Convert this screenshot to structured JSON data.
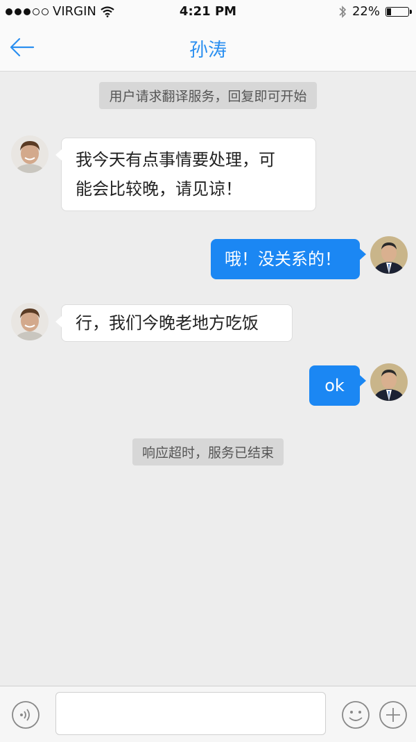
{
  "status_bar": {
    "carrier": "VIRGIN",
    "time": "4:21 PM",
    "battery_percent": "22%",
    "battery_level": 0.22,
    "signal_dots_filled": 3,
    "signal_dots_total": 5
  },
  "nav": {
    "title": "孙涛",
    "back_icon": "back-arrow-icon",
    "accent_color": "#2a8ff0"
  },
  "chat": {
    "system_start": "用户请求翻译服务，回复即可开始",
    "messages": [
      {
        "from": "them",
        "text_line1": "我今天有点事情要处理，可",
        "text_line2": "能会比较晚，请见谅！"
      },
      {
        "from": "me",
        "text": "哦！没关系的！"
      },
      {
        "from": "them",
        "text": "行，我们今晚老地方吃饭"
      },
      {
        "from": "me",
        "text": "ok"
      }
    ],
    "system_end": "响应超时，服务已结束",
    "outgoing_color": "#1b87f3"
  },
  "input_bar": {
    "voice_icon": "voice-icon",
    "emoji_icon": "emoji-icon",
    "plus_icon": "plus-icon",
    "text_value": ""
  }
}
